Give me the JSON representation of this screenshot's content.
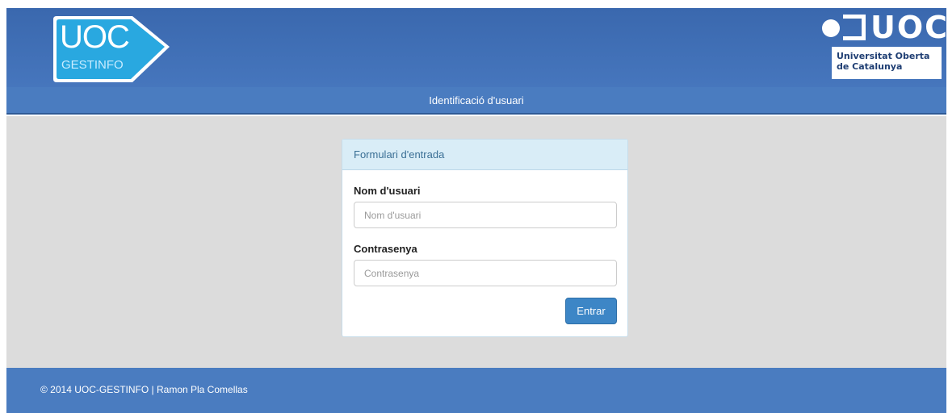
{
  "header": {
    "logo_left": {
      "main": "UOC",
      "sub": "GESTINFO"
    },
    "logo_right": {
      "brand": "UOC",
      "line1": "Universitat Oberta",
      "line2": "de Catalunya"
    }
  },
  "nav": {
    "title": "Identificació d'usuari"
  },
  "form": {
    "heading": "Formulari d'entrada",
    "username_label": "Nom d'usuari",
    "username_placeholder": "Nom d'usuari",
    "username_value": "",
    "password_label": "Contrasenya",
    "password_placeholder": "Contrasenya",
    "password_value": "",
    "submit_label": "Entrar"
  },
  "footer": {
    "text": "© 2014 UOC-GESTINFO | Ramon Pla Comellas"
  },
  "colors": {
    "header_blue": "#3a68ae",
    "nav_blue": "#4a7cc0",
    "logo_cyan": "#29a8e0",
    "panel_head": "#d9edf7",
    "button_blue": "#3d86c6",
    "content_gray": "#dcdcdc"
  }
}
